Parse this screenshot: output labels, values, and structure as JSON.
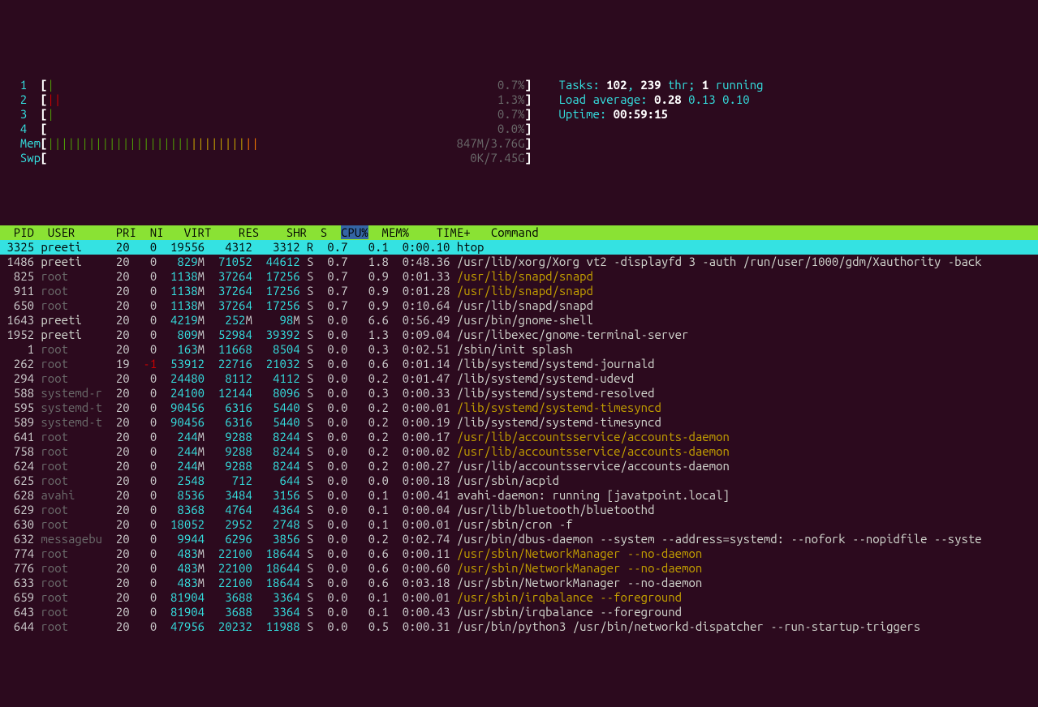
{
  "cpus": [
    {
      "id": "1",
      "bar": "|",
      "barColor": "green",
      "pct": "0.7%"
    },
    {
      "id": "2",
      "bar": "||",
      "barColor": "red",
      "pct": "1.3%"
    },
    {
      "id": "3",
      "bar": "|",
      "barColor": "green",
      "pct": "0.7%"
    },
    {
      "id": "4",
      "bar": "",
      "barColor": "green",
      "pct": "0.0%"
    }
  ],
  "mem": {
    "label": "Mem",
    "barGreen": "|||||||||||||||||||||",
    "barYellow": "||||||||",
    "barOrange": "||",
    "text": "847M/3.76G"
  },
  "swp": {
    "label": "Swp",
    "text": "0K/7.45G"
  },
  "tasks": {
    "label": "Tasks: ",
    "procs": "102",
    "sep1": ", ",
    "threads": "239",
    "thr_label": " thr; ",
    "running": "1",
    "running_label": " running"
  },
  "load": {
    "label": "Load average: ",
    "v1": "0.28",
    "v2": "0.13",
    "v3": "0.10"
  },
  "uptime": {
    "label": "Uptime: ",
    "value": "00:59:15"
  },
  "columns": [
    "  PID",
    " USER     ",
    "PRI",
    " NI",
    "  VIRT",
    "   RES",
    "   SHR",
    " S ",
    "CPU%",
    " MEM%",
    "   TIME+ ",
    " Command"
  ],
  "sortColIndex": 8,
  "processes": [
    {
      "sel": true,
      "pid": " 3325",
      "user": "preeti   ",
      "pri": " 20",
      "ni": "  0",
      "virt": " 19556",
      "res": "  4312",
      "shr": "  3312",
      "s": " R ",
      "cpu": " 0.7",
      "mem": "  0.1",
      "time": " 0:00.10",
      "cmd": " htop",
      "userDim": false,
      "cmdHi": false
    },
    {
      "pid": " 1486",
      "user": "preeti   ",
      "pri": " 20",
      "ni": "  0",
      "virt": "  829M",
      "res": " 71052",
      "shr": " 44612",
      "s": " S ",
      "cpu": " 0.7",
      "mem": "  1.8",
      "time": " 0:48.36",
      "cmd": " /usr/lib/xorg/Xorg vt2 -displayfd 3 -auth /run/user/1000/gdm/Xauthority -back",
      "userDim": false
    },
    {
      "pid": "  825",
      "user": "root     ",
      "pri": " 20",
      "ni": "  0",
      "virt": " 1138M",
      "res": " 37264",
      "shr": " 17256",
      "s": " S ",
      "cpu": " 0.7",
      "mem": "  0.9",
      "time": " 0:01.33",
      "cmd": " /usr/lib/snapd/snapd",
      "userDim": true,
      "cmdHi": true
    },
    {
      "pid": "  911",
      "user": "root     ",
      "pri": " 20",
      "ni": "  0",
      "virt": " 1138M",
      "res": " 37264",
      "shr": " 17256",
      "s": " S ",
      "cpu": " 0.7",
      "mem": "  0.9",
      "time": " 0:01.28",
      "cmd": " /usr/lib/snapd/snapd",
      "userDim": true,
      "cmdHi": true
    },
    {
      "pid": "  650",
      "user": "root     ",
      "pri": " 20",
      "ni": "  0",
      "virt": " 1138M",
      "res": " 37264",
      "shr": " 17256",
      "s": " S ",
      "cpu": " 0.7",
      "mem": "  0.9",
      "time": " 0:10.64",
      "cmd": " /usr/lib/snapd/snapd",
      "userDim": true
    },
    {
      "pid": " 1643",
      "user": "preeti   ",
      "pri": " 20",
      "ni": "  0",
      "virt": " 4219M",
      "res": "  252M",
      "shr": "   98M",
      "s": " S ",
      "cpu": " 0.0",
      "mem": "  6.6",
      "time": " 0:56.49",
      "cmd": " /usr/bin/gnome-shell",
      "userDim": false
    },
    {
      "pid": " 1952",
      "user": "preeti   ",
      "pri": " 20",
      "ni": "  0",
      "virt": "  809M",
      "res": " 52984",
      "shr": " 39392",
      "s": " S ",
      "cpu": " 0.0",
      "mem": "  1.3",
      "time": " 0:09.04",
      "cmd": " /usr/libexec/gnome-terminal-server",
      "userDim": false
    },
    {
      "pid": "    1",
      "user": "root     ",
      "pri": " 20",
      "ni": "  0",
      "virt": "  163M",
      "res": " 11668",
      "shr": "  8504",
      "s": " S ",
      "cpu": " 0.0",
      "mem": "  0.3",
      "time": " 0:02.51",
      "cmd": " /sbin/init splash",
      "userDim": true
    },
    {
      "pid": "  262",
      "user": "root     ",
      "pri": " 19",
      "ni": " -1",
      "virt": " 53912",
      "res": " 22716",
      "shr": " 21032",
      "s": " S ",
      "cpu": " 0.0",
      "mem": "  0.6",
      "time": " 0:01.14",
      "cmd": " /lib/systemd/systemd-journald",
      "userDim": true,
      "niRed": true
    },
    {
      "pid": "  294",
      "user": "root     ",
      "pri": " 20",
      "ni": "  0",
      "virt": " 24480",
      "res": "  8112",
      "shr": "  4112",
      "s": " S ",
      "cpu": " 0.0",
      "mem": "  0.2",
      "time": " 0:01.47",
      "cmd": " /lib/systemd/systemd-udevd",
      "userDim": true
    },
    {
      "pid": "  588",
      "user": "systemd-r",
      "pri": " 20",
      "ni": "  0",
      "virt": " 24100",
      "res": " 12144",
      "shr": "  8096",
      "s": " S ",
      "cpu": " 0.0",
      "mem": "  0.3",
      "time": " 0:00.33",
      "cmd": " /lib/systemd/systemd-resolved",
      "userDim": true
    },
    {
      "pid": "  595",
      "user": "systemd-t",
      "pri": " 20",
      "ni": "  0",
      "virt": " 90456",
      "res": "  6316",
      "shr": "  5440",
      "s": " S ",
      "cpu": " 0.0",
      "mem": "  0.2",
      "time": " 0:00.01",
      "cmd": " /lib/systemd/systemd-timesyncd",
      "userDim": true,
      "cmdHi": true
    },
    {
      "pid": "  589",
      "user": "systemd-t",
      "pri": " 20",
      "ni": "  0",
      "virt": " 90456",
      "res": "  6316",
      "shr": "  5440",
      "s": " S ",
      "cpu": " 0.0",
      "mem": "  0.2",
      "time": " 0:00.19",
      "cmd": " /lib/systemd/systemd-timesyncd",
      "userDim": true
    },
    {
      "pid": "  641",
      "user": "root     ",
      "pri": " 20",
      "ni": "  0",
      "virt": "  244M",
      "res": "  9288",
      "shr": "  8244",
      "s": " S ",
      "cpu": " 0.0",
      "mem": "  0.2",
      "time": " 0:00.17",
      "cmd": " /usr/lib/accountsservice/accounts-daemon",
      "userDim": true,
      "cmdHi": true
    },
    {
      "pid": "  758",
      "user": "root     ",
      "pri": " 20",
      "ni": "  0",
      "virt": "  244M",
      "res": "  9288",
      "shr": "  8244",
      "s": " S ",
      "cpu": " 0.0",
      "mem": "  0.2",
      "time": " 0:00.02",
      "cmd": " /usr/lib/accountsservice/accounts-daemon",
      "userDim": true,
      "cmdHi": true
    },
    {
      "pid": "  624",
      "user": "root     ",
      "pri": " 20",
      "ni": "  0",
      "virt": "  244M",
      "res": "  9288",
      "shr": "  8244",
      "s": " S ",
      "cpu": " 0.0",
      "mem": "  0.2",
      "time": " 0:00.27",
      "cmd": " /usr/lib/accountsservice/accounts-daemon",
      "userDim": true
    },
    {
      "pid": "  625",
      "user": "root     ",
      "pri": " 20",
      "ni": "  0",
      "virt": "  2548",
      "res": "   712",
      "shr": "   644",
      "s": " S ",
      "cpu": " 0.0",
      "mem": "  0.0",
      "time": " 0:00.18",
      "cmd": " /usr/sbin/acpid",
      "userDim": true
    },
    {
      "pid": "  628",
      "user": "avahi    ",
      "pri": " 20",
      "ni": "  0",
      "virt": "  8536",
      "res": "  3484",
      "shr": "  3156",
      "s": " S ",
      "cpu": " 0.0",
      "mem": "  0.1",
      "time": " 0:00.41",
      "cmd": " avahi-daemon: running [javatpoint.local]",
      "userDim": true
    },
    {
      "pid": "  629",
      "user": "root     ",
      "pri": " 20",
      "ni": "  0",
      "virt": "  8368",
      "res": "  4764",
      "shr": "  4364",
      "s": " S ",
      "cpu": " 0.0",
      "mem": "  0.1",
      "time": " 0:00.04",
      "cmd": " /usr/lib/bluetooth/bluetoothd",
      "userDim": true
    },
    {
      "pid": "  630",
      "user": "root     ",
      "pri": " 20",
      "ni": "  0",
      "virt": " 18052",
      "res": "  2952",
      "shr": "  2748",
      "s": " S ",
      "cpu": " 0.0",
      "mem": "  0.1",
      "time": " 0:00.01",
      "cmd": " /usr/sbin/cron -f",
      "userDim": true
    },
    {
      "pid": "  632",
      "user": "messagebu",
      "pri": " 20",
      "ni": "  0",
      "virt": "  9944",
      "res": "  6296",
      "shr": "  3856",
      "s": " S ",
      "cpu": " 0.0",
      "mem": "  0.2",
      "time": " 0:02.74",
      "cmd": " /usr/bin/dbus-daemon --system --address=systemd: --nofork --nopidfile --syste",
      "userDim": true
    },
    {
      "pid": "  774",
      "user": "root     ",
      "pri": " 20",
      "ni": "  0",
      "virt": "  483M",
      "res": " 22100",
      "shr": " 18644",
      "s": " S ",
      "cpu": " 0.0",
      "mem": "  0.6",
      "time": " 0:00.11",
      "cmd": " /usr/sbin/NetworkManager --no-daemon",
      "userDim": true,
      "cmdHi": true
    },
    {
      "pid": "  776",
      "user": "root     ",
      "pri": " 20",
      "ni": "  0",
      "virt": "  483M",
      "res": " 22100",
      "shr": " 18644",
      "s": " S ",
      "cpu": " 0.0",
      "mem": "  0.6",
      "time": " 0:00.60",
      "cmd": " /usr/sbin/NetworkManager --no-daemon",
      "userDim": true,
      "cmdHi": true
    },
    {
      "pid": "  633",
      "user": "root     ",
      "pri": " 20",
      "ni": "  0",
      "virt": "  483M",
      "res": " 22100",
      "shr": " 18644",
      "s": " S ",
      "cpu": " 0.0",
      "mem": "  0.6",
      "time": " 0:03.18",
      "cmd": " /usr/sbin/NetworkManager --no-daemon",
      "userDim": true
    },
    {
      "pid": "  659",
      "user": "root     ",
      "pri": " 20",
      "ni": "  0",
      "virt": " 81904",
      "res": "  3688",
      "shr": "  3364",
      "s": " S ",
      "cpu": " 0.0",
      "mem": "  0.1",
      "time": " 0:00.01",
      "cmd": " /usr/sbin/irqbalance --foreground",
      "userDim": true,
      "cmdHi": true
    },
    {
      "pid": "  643",
      "user": "root     ",
      "pri": " 20",
      "ni": "  0",
      "virt": " 81904",
      "res": "  3688",
      "shr": "  3364",
      "s": " S ",
      "cpu": " 0.0",
      "mem": "  0.1",
      "time": " 0:00.43",
      "cmd": " /usr/sbin/irqbalance --foreground",
      "userDim": true
    },
    {
      "pid": "  644",
      "user": "root     ",
      "pri": " 20",
      "ni": "  0",
      "virt": " 47956",
      "res": " 20232",
      "shr": " 11988",
      "s": " S ",
      "cpu": " 0.0",
      "mem": "  0.5",
      "time": " 0:00.31",
      "cmd": " /usr/bin/python3 /usr/bin/networkd-dispatcher --run-startup-triggers",
      "userDim": true
    }
  ]
}
